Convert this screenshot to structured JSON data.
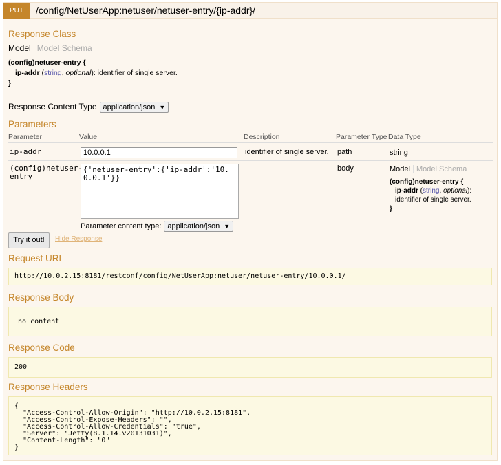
{
  "operation": {
    "method": "PUT",
    "path": "/config/NetUserApp:netuser/netuser-entry/{ip-addr}/"
  },
  "response_class": {
    "title": "Response Class",
    "tab_model": "Model",
    "tab_schema": "Model Schema",
    "sig_name": "(config)netuser-entry {",
    "prop_name": "ip-addr",
    "prop_type": "string",
    "prop_optional": "optional",
    "prop_desc": "): identifier of single server.",
    "sig_close": "}"
  },
  "response_content_type": {
    "label": "Response Content Type",
    "value": "application/json"
  },
  "parameters": {
    "title": "Parameters",
    "headers": [
      "Parameter",
      "Value",
      "Description",
      "Parameter Type",
      "Data Type"
    ],
    "rows": [
      {
        "name": "ip-addr",
        "value": "10.0.0.1",
        "description": "identifier of single server.",
        "param_type": "path",
        "data_type": "string"
      },
      {
        "name_line1": "(config)netuser-",
        "name_line2": "entry",
        "value": "{'netuser-entry':{'ip-addr':'10.0.0.1'}}",
        "param_type": "body",
        "content_type_label": "Parameter content type:",
        "content_type_value": "application/json",
        "model_tab": "Model",
        "schema_tab": "Model Schema",
        "model_sig": "(config)netuser-entry {",
        "model_prop": "ip-addr",
        "model_type": "string",
        "model_optional": "optional",
        "model_desc1": "):",
        "model_desc2": "identifier of single server.",
        "model_close": "}"
      }
    ]
  },
  "actions": {
    "try_label": "Try it out!",
    "hide_label": "Hide Response"
  },
  "request_url": {
    "title": "Request URL",
    "value": "http://10.0.2.15:8181/restconf/config/NetUserApp:netuser/netuser-entry/10.0.0.1/"
  },
  "response_body": {
    "title": "Response Body",
    "value": "no content"
  },
  "response_code": {
    "title": "Response Code",
    "value": "200"
  },
  "response_headers": {
    "title": "Response Headers",
    "value": "{\n  \"Access-Control-Allow-Origin\": \"http://10.0.2.15:8181\",\n  \"Access-Control-Expose-Headers\": \"\",\n  \"Access-Control-Allow-Credentials\": \"true\",\n  \"Server\": \"Jetty(8.1.14.v20131031)\",\n  \"Content-Length\": \"0\"\n}"
  },
  "colors": {
    "accent": "#c5862b",
    "panel_bg": "#fcf6ee",
    "block_bg": "#fcf9e3"
  }
}
